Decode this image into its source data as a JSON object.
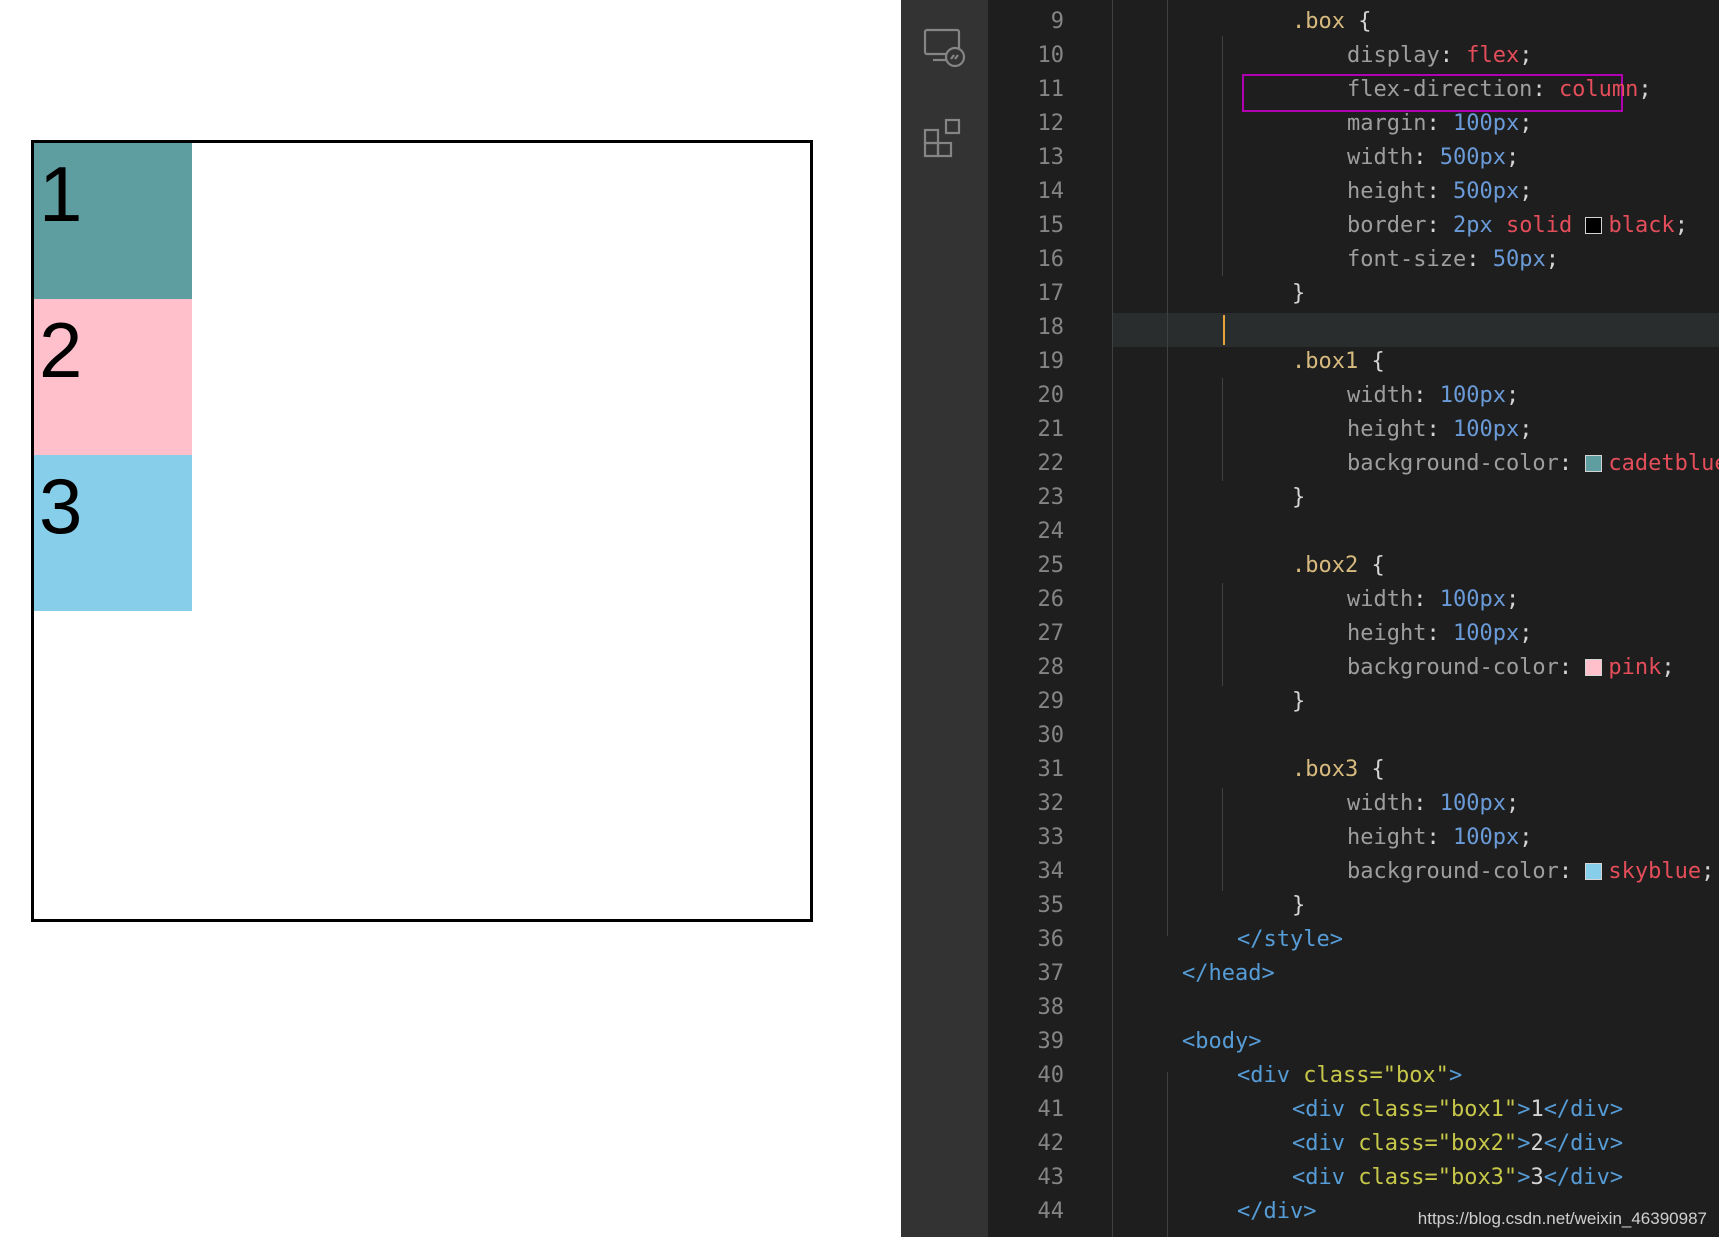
{
  "preview": {
    "items": [
      {
        "label": "1",
        "color": "#5f9ea0"
      },
      {
        "label": "2",
        "color": "#ffc0cb"
      },
      {
        "label": "3",
        "color": "#87ceeb"
      }
    ]
  },
  "activity_bar": {
    "icons": [
      "remote-explorer-icon",
      "extensions-icon"
    ]
  },
  "editor": {
    "line_numbers": [
      "9",
      "10",
      "11",
      "12",
      "13",
      "14",
      "15",
      "16",
      "17",
      "18",
      "19",
      "20",
      "21",
      "22",
      "23",
      "24",
      "25",
      "26",
      "27",
      "28",
      "29",
      "30",
      "31",
      "32",
      "33",
      "34",
      "35",
      "36",
      "37",
      "38",
      "39",
      "40",
      "41",
      "42",
      "43",
      "44"
    ],
    "current_line": "18",
    "highlighted_line": "11",
    "code": {
      "l9": {
        "sel": ".box",
        "brace": " {"
      },
      "l10": {
        "prop": "display",
        "colon": ": ",
        "val": "flex",
        "semi": ";"
      },
      "l11": {
        "prop": "flex-direction",
        "colon": ": ",
        "val": "column",
        "semi": ";"
      },
      "l12": {
        "prop": "margin",
        "colon": ": ",
        "num": "100",
        "unit": "px",
        "semi": ";"
      },
      "l13": {
        "prop": "width",
        "colon": ": ",
        "num": "500",
        "unit": "px",
        "semi": ";"
      },
      "l14": {
        "prop": "height",
        "colon": ": ",
        "num": "500",
        "unit": "px",
        "semi": ";"
      },
      "l15": {
        "prop": "border",
        "colon": ": ",
        "num": "2",
        "unit": "px",
        "val1": " solid ",
        "val2": "black",
        "semi": ";",
        "swatch": "#000000"
      },
      "l16": {
        "prop": "font-size",
        "colon": ": ",
        "num": "50",
        "unit": "px",
        "semi": ";"
      },
      "l17": {
        "brace": "}"
      },
      "l19": {
        "sel": ".box1",
        "brace": " {"
      },
      "l20": {
        "prop": "width",
        "colon": ": ",
        "num": "100",
        "unit": "px",
        "semi": ";"
      },
      "l21": {
        "prop": "height",
        "colon": ": ",
        "num": "100",
        "unit": "px",
        "semi": ";"
      },
      "l22": {
        "prop": "background-color",
        "colon": ": ",
        "val": "cadetblue",
        "semi": ";",
        "swatch": "#5f9ea0"
      },
      "l23": {
        "brace": "}"
      },
      "l25": {
        "sel": ".box2",
        "brace": " {"
      },
      "l26": {
        "prop": "width",
        "colon": ": ",
        "num": "100",
        "unit": "px",
        "semi": ";"
      },
      "l27": {
        "prop": "height",
        "colon": ": ",
        "num": "100",
        "unit": "px",
        "semi": ";"
      },
      "l28": {
        "prop": "background-color",
        "colon": ": ",
        "val": "pink",
        "semi": ";",
        "swatch": "#ffc0cb"
      },
      "l29": {
        "brace": "}"
      },
      "l31": {
        "sel": ".box3",
        "brace": " {"
      },
      "l32": {
        "prop": "width",
        "colon": ": ",
        "num": "100",
        "unit": "px",
        "semi": ";"
      },
      "l33": {
        "prop": "height",
        "colon": ": ",
        "num": "100",
        "unit": "px",
        "semi": ";"
      },
      "l34": {
        "prop": "background-color",
        "colon": ": ",
        "val": "skyblue",
        "semi": ";",
        "swatch": "#87ceeb"
      },
      "l35": {
        "brace": "}"
      },
      "l36": {
        "tag": "</style>"
      },
      "l37": {
        "tag": "</head>"
      },
      "l39": {
        "tag": "<body>"
      },
      "l40": {
        "open": "<div",
        "attr": " class=",
        "str": "\"box\"",
        "close": ">"
      },
      "l41": {
        "open": "<div",
        "attr": " class=",
        "str": "\"box1\"",
        "close": ">",
        "txt": "1",
        "end": "</div>"
      },
      "l42": {
        "open": "<div",
        "attr": " class=",
        "str": "\"box2\"",
        "close": ">",
        "txt": "2",
        "end": "</div>"
      },
      "l43": {
        "open": "<div",
        "attr": " class=",
        "str": "\"box3\"",
        "close": ">",
        "txt": "3",
        "end": "</div>"
      },
      "l44": {
        "tag": "</div>"
      }
    }
  },
  "watermark": "https://blog.csdn.net/weixin_46390987"
}
